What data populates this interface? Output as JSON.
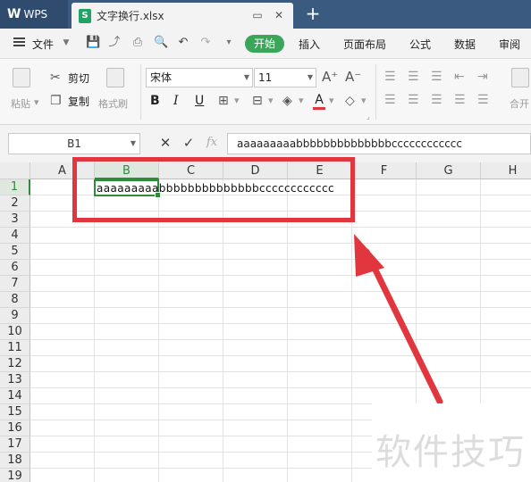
{
  "titlebar": {
    "app_label": "WPS",
    "file_tab": "文字换行.xlsx",
    "file_icon_letter": "S",
    "add_tab": "+"
  },
  "menu": {
    "file_label": "文件",
    "start_label": "开始",
    "tabs": [
      "插入",
      "页面布局",
      "公式",
      "数据",
      "审阅"
    ]
  },
  "ribbon": {
    "paste_label": "粘贴",
    "cut_label": "剪切",
    "copy_label": "复制",
    "format_painter_label": "格式刷",
    "font_name": "宋体",
    "font_size": "11",
    "merge_label": "合开"
  },
  "formula_bar": {
    "name_box": "B1",
    "formula_value": "aaaaaaaaabbbbbbbbbbbbbbcccccccccccc"
  },
  "grid": {
    "columns": [
      "A",
      "B",
      "C",
      "D",
      "E",
      "F",
      "G",
      "H"
    ],
    "rows": [
      "1",
      "2",
      "3",
      "4",
      "5",
      "6",
      "7",
      "8",
      "9",
      "10",
      "11",
      "12",
      "13",
      "14",
      "15",
      "16",
      "17",
      "18",
      "19"
    ],
    "active_column": "B",
    "active_row": "1",
    "cell_b1": "aaaaaaaaabbbbbbbbbbbbbbcccccccccccc"
  },
  "watermark": "软件技巧",
  "colors": {
    "accent_green": "#2e8b3c",
    "annotation_red": "#e2363e",
    "titlebar_blue": "#3b5a80"
  }
}
